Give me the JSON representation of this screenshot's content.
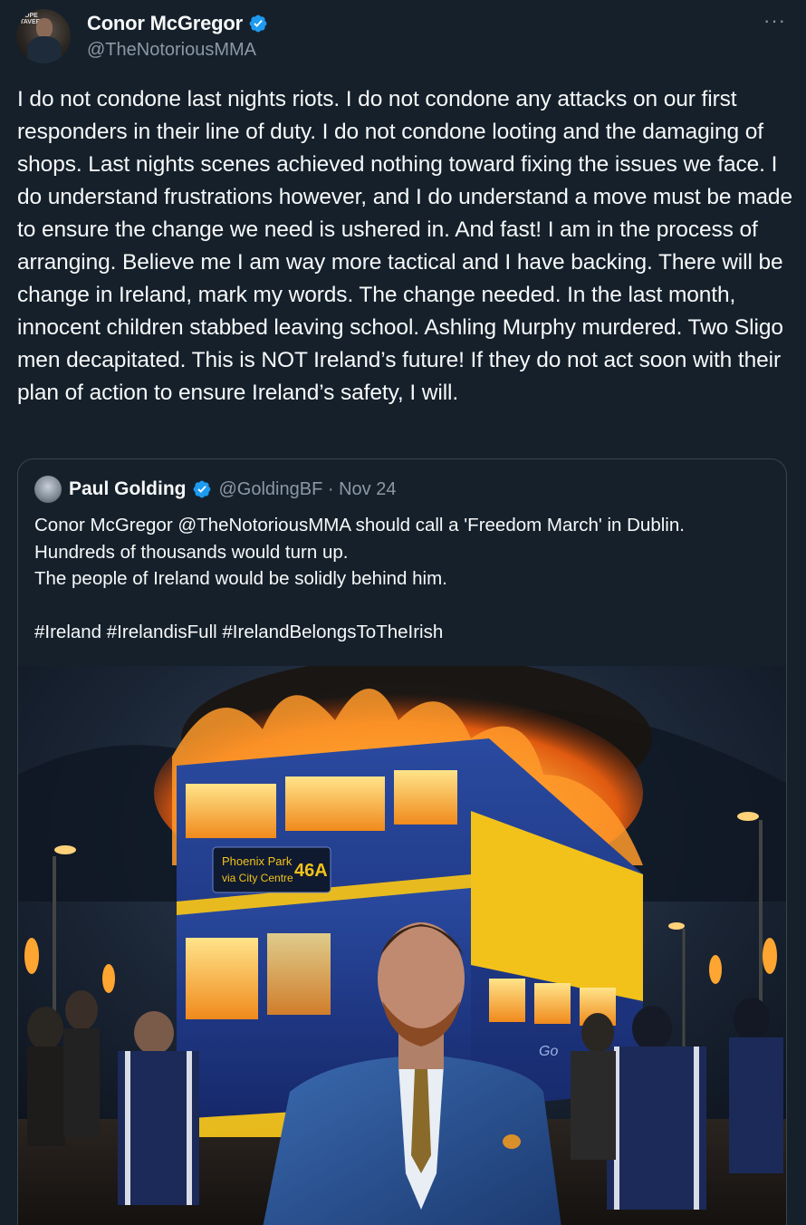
{
  "author": {
    "display_name": "Conor McGregor",
    "handle": "@TheNotoriousMMA",
    "verified_icon": "verified-badge-icon",
    "avatar_sign_text": "HOPE\nTAVERN"
  },
  "more_icon": "more-options-icon",
  "tweet_text": "I do not condone last nights riots. I do not condone any attacks on our first responders in their line of duty. I do not condone looting and the damaging of shops. Last nights scenes achieved nothing toward fixing the issues we face. I do understand frustrations however, and I do understand a move must be made to ensure the change we need is ushered in. And fast! I am in the process of arranging. Believe me I am way more tactical and I have backing. There will be change in Ireland, mark my words. The change needed. In the last month, innocent children stabbed leaving school. Ashling Murphy murdered. Two Sligo men decapitated. This is NOT Ireland’s future! If they do not act soon with their plan of action to ensure Ireland’s safety, I will.",
  "quoted": {
    "display_name": "Paul Golding",
    "handle_date": "@GoldingBF · Nov 24",
    "text": "Conor McGregor @TheNotoriousMMA should call a 'Freedom March' in Dublin.\nHundreds of thousands would turn up.\nThe people of Ireland would be solidly behind him.\n\n#Ireland #IrelandisFull #IrelandBelongsToTheIrish",
    "image": {
      "bus_sign_line1": "Phoenix Park",
      "bus_sign_line2": "via City Centre",
      "bus_route": "46A",
      "bus_side_logo": "Go"
    }
  },
  "colors": {
    "background": "#15202b",
    "text": "#f7f9f9",
    "muted": "#8b98a5",
    "border": "#38444d",
    "verified": "#1d9bf0"
  }
}
